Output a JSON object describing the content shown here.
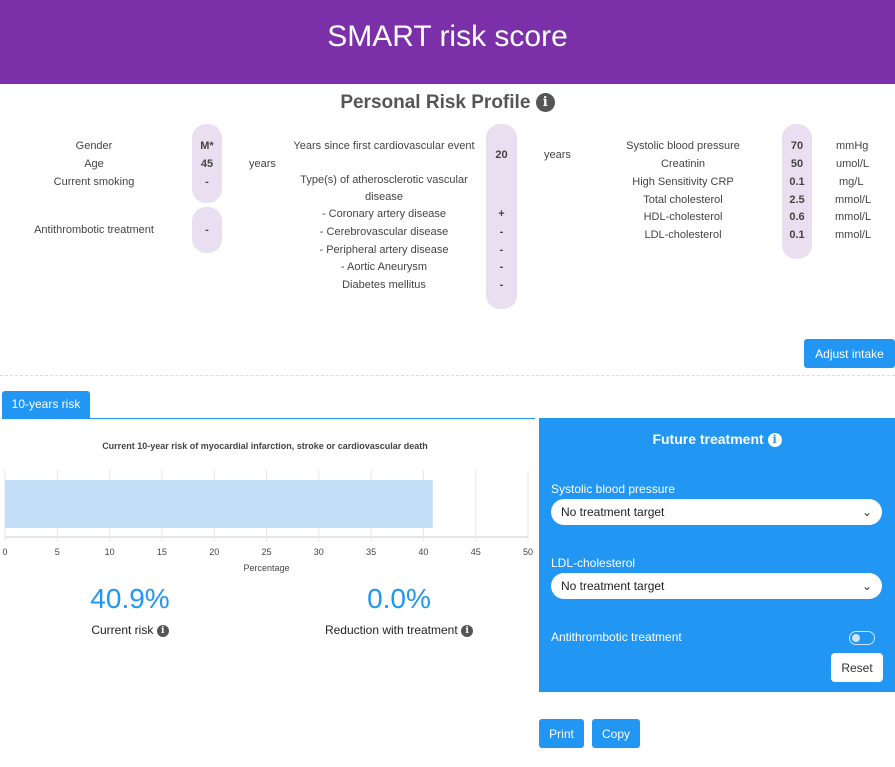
{
  "header": {
    "title": "SMART risk score"
  },
  "profile": {
    "title": "Personal Risk Profile",
    "col1": {
      "gender_label": "Gender",
      "gender_value": "M*",
      "age_label": "Age",
      "age_value": "45",
      "age_unit": "years",
      "smoking_label": "Current smoking",
      "smoking_value": "-",
      "antithrombotic_label": "Antithrombotic treatment",
      "antithrombotic_value": "-"
    },
    "col2": {
      "years_label": "Years since first cardiovascular event",
      "years_value": "20",
      "years_unit": "years",
      "types_label": "Type(s) of atherosclerotic vascular disease",
      "items": [
        {
          "label": "- Coronary artery disease",
          "value": "+"
        },
        {
          "label": "- Cerebrovascular disease",
          "value": "-"
        },
        {
          "label": "- Peripheral artery disease",
          "value": "-"
        },
        {
          "label": "- Aortic Aneurysm",
          "value": "-"
        },
        {
          "label": "Diabetes mellitus",
          "value": "-"
        }
      ]
    },
    "col3": {
      "items": [
        {
          "label": "Systolic blood pressure",
          "value": "70",
          "unit": "mmHg"
        },
        {
          "label": "Creatinin",
          "value": "50",
          "unit": "umol/L"
        },
        {
          "label": "High Sensitivity CRP",
          "value": "0.1",
          "unit": "mg/L"
        },
        {
          "label": "Total cholesterol",
          "value": "2.5",
          "unit": "mmol/L"
        },
        {
          "label": "HDL-cholesterol",
          "value": "0.6",
          "unit": "mmol/L"
        },
        {
          "label": "LDL-cholesterol",
          "value": "0.1",
          "unit": "mmol/L"
        }
      ]
    },
    "info_icon": "info-icon"
  },
  "adjust_label": "Adjust intake",
  "tab_label": "10-years risk",
  "chart_data": {
    "type": "bar",
    "orientation": "horizontal",
    "title": "Current 10-year risk of myocardial infarction, stroke or cardiovascular death",
    "xlabel": "Percentage",
    "ylabel": "",
    "categories": [
      ""
    ],
    "values": [
      40.9
    ],
    "xlim": [
      0,
      50
    ],
    "xticks": [
      "0",
      "5",
      "10",
      "15",
      "20",
      "25",
      "30",
      "35",
      "40",
      "45",
      "50"
    ],
    "grid": true,
    "bar_color": "#c4dff8"
  },
  "results": {
    "current_risk_value": "40.9%",
    "current_risk_label": "Current risk",
    "reduction_value": "0.0%",
    "reduction_label": "Reduction with treatment"
  },
  "future": {
    "title": "Future treatment",
    "sbp_label": "Systolic blood pressure",
    "sbp_value": "No treatment target",
    "ldl_label": "LDL-cholesterol",
    "ldl_value": "No treatment target",
    "antithrombotic_label": "Antithrombotic treatment",
    "antithrombotic_on": false,
    "reset_label": "Reset",
    "panel_color": "#2196f3"
  },
  "actions": {
    "print_label": "Print",
    "copy_label": "Copy"
  },
  "colors": {
    "header": "#7b2fa8",
    "accent": "#2196f3",
    "pill": "#eadff0"
  }
}
